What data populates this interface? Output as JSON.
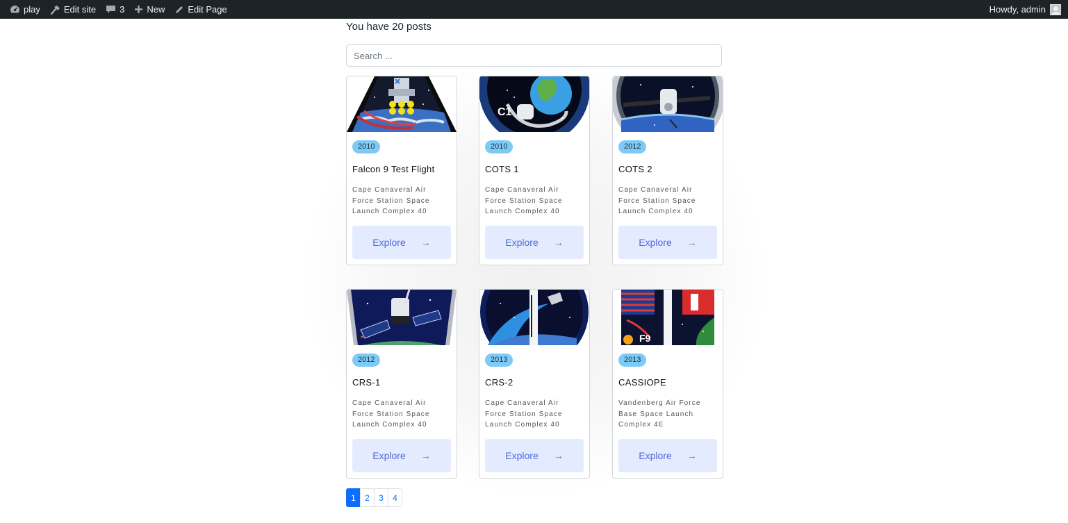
{
  "adminbar": {
    "site_name": "play",
    "edit_site": "Edit site",
    "comments_count": "3",
    "new_label": "New",
    "edit_page": "Edit Page",
    "howdy": "Howdy, admin"
  },
  "posts_count_text": "You have 20 posts",
  "search": {
    "placeholder": "Search ..."
  },
  "cards": [
    {
      "year": "2010",
      "title": "Falcon 9 Test Flight",
      "site": "Cape Canaveral Air Force Station Space Launch Complex 40",
      "button": "Explore",
      "icon": "falcon9-patch-icon"
    },
    {
      "year": "2010",
      "title": "COTS 1",
      "site": "Cape Canaveral Air Force Station Space Launch Complex 40",
      "button": "Explore",
      "icon": "cots1-patch-icon"
    },
    {
      "year": "2012",
      "title": "COTS 2",
      "site": "Cape Canaveral Air Force Station Space Launch Complex 40",
      "button": "Explore",
      "icon": "cots2-patch-icon"
    },
    {
      "year": "2012",
      "title": "CRS-1",
      "site": "Cape Canaveral Air Force Station Space Launch Complex 40",
      "button": "Explore",
      "icon": "crs1-patch-icon"
    },
    {
      "year": "2013",
      "title": "CRS-2",
      "site": "Cape Canaveral Air Force Station Space Launch Complex 40",
      "button": "Explore",
      "icon": "crs2-patch-icon"
    },
    {
      "year": "2013",
      "title": "CASSIOPE",
      "site": "Vandenberg Air Force Base Space Launch Complex 4E",
      "button": "Explore",
      "icon": "cassiope-patch-icon"
    }
  ],
  "patch_text": {
    "cots1": "C1",
    "cassiope": "F9"
  },
  "pagination": {
    "pages": [
      "1",
      "2",
      "3",
      "4"
    ],
    "current": "1"
  }
}
